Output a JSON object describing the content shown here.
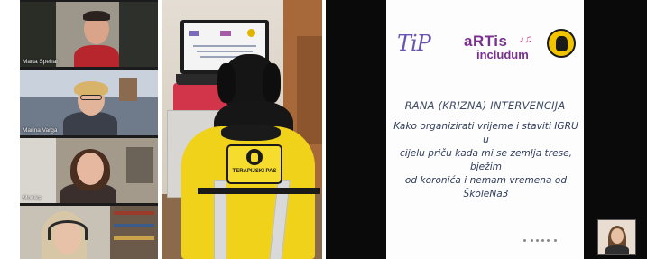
{
  "participants": [
    {
      "name": "Marta Spehar"
    },
    {
      "name": "Marina Varga"
    },
    {
      "name": "Monika"
    },
    {
      "name": ""
    }
  ],
  "dog_photo": {
    "vest_label": "TERAPIJSKI PAS"
  },
  "shared_screen": {
    "logos": {
      "left": "TiP",
      "center_line1": "aRTis",
      "center_line2": "includum"
    },
    "heading": "RANA (KRIZNA) INTERVENCIJA",
    "body_lines": [
      "Kako organizirati vrijeme i staviti IGRU u",
      "cijelu priču kada mi se zemlja trese, bježim",
      "od koronića i nemam vremena od",
      "ŠkoleNa3"
    ],
    "accent_color": "#7a2f8f"
  }
}
